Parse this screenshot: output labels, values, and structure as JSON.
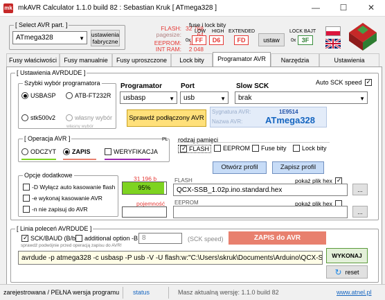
{
  "window": {
    "title": "mkAVR Calculator 1.1.0 build 82 : Sebastian Kruk   [ ATmega328 ]",
    "app_icon": "mk",
    "min": "—",
    "max": "☐",
    "close": "✕"
  },
  "avr_select": {
    "label": "[ Select AVR part. ]",
    "value": "ATmega328",
    "factory_button": "ustawienia\nfabryczne"
  },
  "memory": {
    "flash_label": "FLASH:",
    "flash_value": "32 768",
    "pagesize_label": "pagesize:",
    "pagesize_value": "64",
    "eeprom_label": "EEPROM:",
    "eeprom_value": "1 024",
    "ram_label": "INT RAM:",
    "ram_value": "2 048"
  },
  "fuses": {
    "label": "fuse i lock bity",
    "low_label": "LOW",
    "high_label": "HIGH",
    "ext_label": "EXTENDED",
    "lock_label": "LOCK BAJT",
    "prefix": "0x",
    "low": "FF",
    "high": "D6",
    "ext": "FD",
    "lock": "3F",
    "set_button": "ustaw"
  },
  "tabs": [
    "Fusy właściwości",
    "Fusy manualnie",
    "Fusy uproszczone",
    "Lock bity",
    "Programator AVR",
    "Narzędzia",
    "Ustawienia"
  ],
  "active_tab": "Programator AVR",
  "avrdude_group": {
    "label": "[ Ustawienia AVRDUDE ]"
  },
  "quick_prog": {
    "label": "Szybki wybór programatora",
    "usbasp": "USBASP",
    "atb": "ATB-FT232R",
    "stk": "stk500v2",
    "own": "własny wybór",
    "own_note": "własny wybór"
  },
  "programmer": {
    "label": "Programator",
    "value": "usbasp"
  },
  "port": {
    "label": "Port",
    "value": "usb"
  },
  "slow_sck": {
    "label": "Slow SCK",
    "value": "brak"
  },
  "auto_sck": {
    "label": "Auto SCK speed"
  },
  "check_button": "Sprawdź podłączony AVR",
  "signature": {
    "sig_label": "Sygnatura AVR:",
    "sig_value": "1E9514",
    "name_label": "Nazwa AVR:",
    "name_value": "ATmega328"
  },
  "operation": {
    "label": "[ Operacja AVR ]",
    "lang": "PL",
    "read": "ODCZYT",
    "write": "ZAPIS",
    "verify": "WERYFIKACJA"
  },
  "memory_kind": {
    "label": "rodzaj pamięci",
    "flash": "FLASH",
    "eeprom": "EEPROM",
    "fuse": "Fuse bity",
    "lock": "Lock bity"
  },
  "profile": {
    "open": "Otwórz profil",
    "save": "Zapisz profil"
  },
  "options": {
    "label": "Opcje dodatkowe",
    "opt1": "-D Wyłącz auto kasowanie flash",
    "opt2": "-e wykonaj kasowanie AVR",
    "opt3": "-n nie zapisuj do AVR"
  },
  "flash_usage": {
    "bytes": "31 196 b",
    "percent": "95%",
    "fill": 0.95,
    "capacity_label": "pojemność"
  },
  "flash_file": {
    "label": "FLASH",
    "show_label": "pokaż plik hex",
    "value": "QCX-SSB_1.02p.ino.standard.hex",
    "browse": "..."
  },
  "eeprom_file": {
    "label": "EEPROM",
    "show_label": "pokaż plik hex",
    "value": "",
    "browse": "..."
  },
  "cmdline": {
    "label": "[ Linia poleceń AVRDUDE ]",
    "sck_label": "SCK/BAUD (B/b)",
    "additional_label": "additional option -B",
    "speed_value": "8",
    "speed_unit": "(SCK speed)",
    "note": "sprawdź podwójnie przed operacją zapisu do AVR!",
    "banner": "ZAPIS do AVR",
    "command": "avrdude -p atmega328 -c usbasp -P usb -V  -U flash:w:\"C:\\Users\\skruk\\Documents\\Arduino\\QCX-SSB",
    "execute": "WYKONAJ",
    "reset": "reset"
  },
  "status": {
    "registered": "zarejestrowana / PEŁNA wersja programu",
    "status": "status",
    "version": "Masz aktualną wersję: 1.1.0 build 82",
    "link": "www.atnel.pl"
  },
  "colors": {
    "accent_red": "#e53935",
    "accent_blue": "#1565c0",
    "green_bar": "#7ed321",
    "banner": "#e8806e",
    "command_bg": "#fffde7"
  }
}
